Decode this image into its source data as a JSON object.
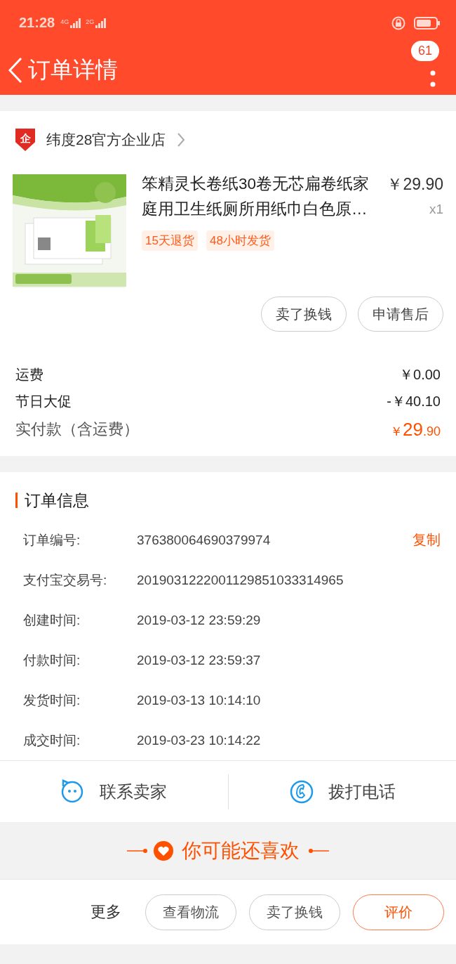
{
  "status_bar": {
    "time": "21:28",
    "network_labels": [
      "4G",
      "2G"
    ]
  },
  "nav": {
    "title": "订单详情",
    "badge": "61"
  },
  "shop": {
    "badge": "企",
    "name": "纬度28官方企业店"
  },
  "product": {
    "image": {
      "kind": "picture"
    },
    "title": "笨精灵长卷纸30卷无芯扁卷纸家庭用卫生纸厕所用纸巾白色原…",
    "price": "￥29.90",
    "quantity": "x1",
    "tags": [
      "15天退货",
      "48小时发货"
    ],
    "actions": [
      "卖了换钱",
      "申请售后"
    ]
  },
  "fees": [
    {
      "label": "运费",
      "value": "￥0.00"
    },
    {
      "label": "节日大促",
      "value": "-￥40.10"
    }
  ],
  "total": {
    "label": "实付款（含运费）",
    "currency": "￥",
    "integer": "29",
    "decimal": ".90"
  },
  "order_info": {
    "title": "订单信息",
    "rows": [
      {
        "label": "订单编号:",
        "value": "376380064690379974",
        "action": "复制"
      },
      {
        "label": "支付宝交易号:",
        "value": "2019031222001129851033314965"
      },
      {
        "label": "创建时间:",
        "value": "2019-03-12 23:59:29"
      },
      {
        "label": "付款时间:",
        "value": "2019-03-12 23:59:37"
      },
      {
        "label": "发货时间:",
        "value": "2019-03-13 10:14:10"
      },
      {
        "label": "成交时间:",
        "value": "2019-03-23 10:14:22"
      }
    ]
  },
  "contact": [
    {
      "kind": "chat",
      "label": "联系卖家"
    },
    {
      "kind": "phone",
      "label": "拨打电话"
    }
  ],
  "recommend": {
    "title": "你可能还喜欢"
  },
  "bottom_bar": {
    "more": "更多",
    "buttons": [
      {
        "label": "查看物流",
        "primary": false
      },
      {
        "label": "卖了换钱",
        "primary": false
      },
      {
        "label": "评价",
        "primary": true
      }
    ]
  }
}
